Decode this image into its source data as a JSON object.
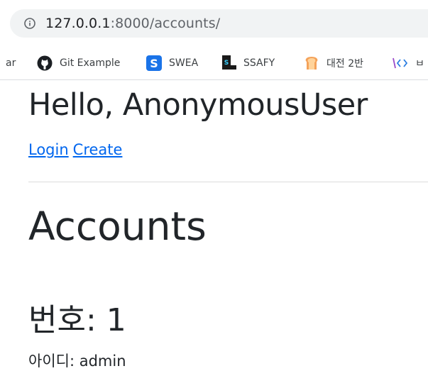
{
  "browser": {
    "url_host": "127.0.0.1",
    "url_path": ":8000/accounts/",
    "bookmarks": [
      {
        "label": "ar",
        "icon": "truncated"
      },
      {
        "label": "Git Example",
        "icon": "github-icon"
      },
      {
        "label": "SWEA",
        "icon": "swea-icon"
      },
      {
        "label": "SSAFY",
        "icon": "ssafy-icon"
      },
      {
        "label": "대전 2반",
        "icon": "bread-icon"
      },
      {
        "label": "ㅂ",
        "icon": "code-icon"
      }
    ]
  },
  "page": {
    "greeting": "Hello, AnonymousUser",
    "links": {
      "login": "Login",
      "create": "Create"
    },
    "heading": "Accounts",
    "account": {
      "number": "번호: 1",
      "userid": "아이디: admin"
    }
  },
  "colors": {
    "link": "#0066ee",
    "heading": "#212529",
    "omnibox": "#f1f3f4"
  }
}
